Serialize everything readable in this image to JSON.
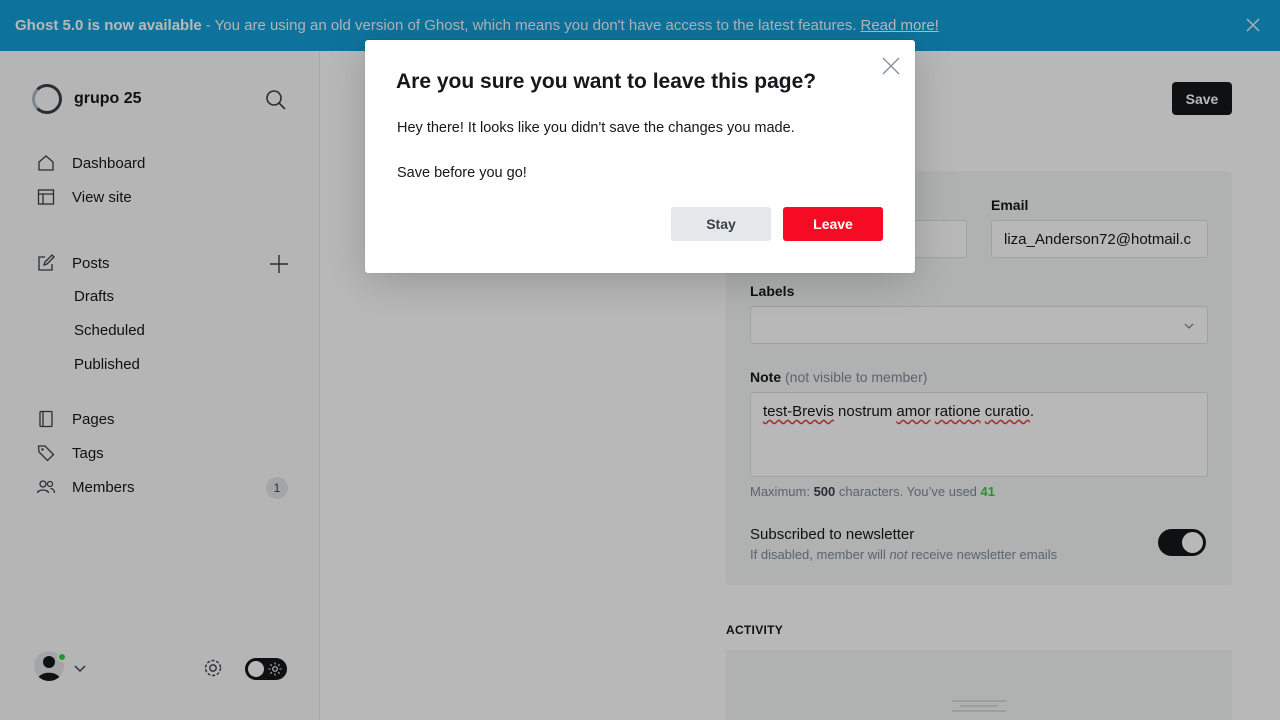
{
  "banner": {
    "headline": "Ghost 5.0 is now available",
    "message": "- You are using an old version of Ghost, which means you don't have access to the latest features.",
    "link": "Read more!",
    "close_icon": "close-icon"
  },
  "sidebar": {
    "site_name": "grupo 25",
    "items": [
      {
        "label": "Dashboard",
        "icon": "home-icon"
      },
      {
        "label": "View site",
        "icon": "layout-icon"
      },
      {
        "label": "Posts",
        "icon": "edit-icon"
      },
      {
        "label": "Drafts"
      },
      {
        "label": "Scheduled"
      },
      {
        "label": "Published"
      },
      {
        "label": "Pages",
        "icon": "page-icon"
      },
      {
        "label": "Tags",
        "icon": "tag-icon"
      },
      {
        "label": "Members",
        "icon": "members-icon",
        "count": "1"
      }
    ]
  },
  "main": {
    "save_label": "Save",
    "email_label": "Email",
    "email_value": "liza_Anderson72@hotmail.c",
    "labels_label": "Labels",
    "note_label": "Note",
    "note_sublabel": "(not visible to member)",
    "note_value": {
      "w1": "test-Brevis",
      "w2": " nostrum ",
      "w3": "amor",
      "w4": " ",
      "w5": "ratione",
      "w6": " ",
      "w7": "curatio",
      "w8": "."
    },
    "hint_prefix": "Maximum: ",
    "hint_max": "500",
    "hint_mid": " characters. You’ve used ",
    "hint_used": "41",
    "newsletter_title": "Subscribed to newsletter",
    "newsletter_desc_pre": "If disabled, member will ",
    "newsletter_desc_em": "not",
    "newsletter_desc_post": " receive newsletter emails",
    "newsletter_on": true,
    "activity_title": "ACTIVITY"
  },
  "modal": {
    "title": "Are you sure you want to leave this page?",
    "body1": "Hey there! It looks like you didn't save the changes you made.",
    "body2": "Save before you go!",
    "stay_label": "Stay",
    "leave_label": "Leave"
  },
  "colors": {
    "banner": "#14a0d8",
    "leave": "#f50b23",
    "online": "#30cf43"
  }
}
